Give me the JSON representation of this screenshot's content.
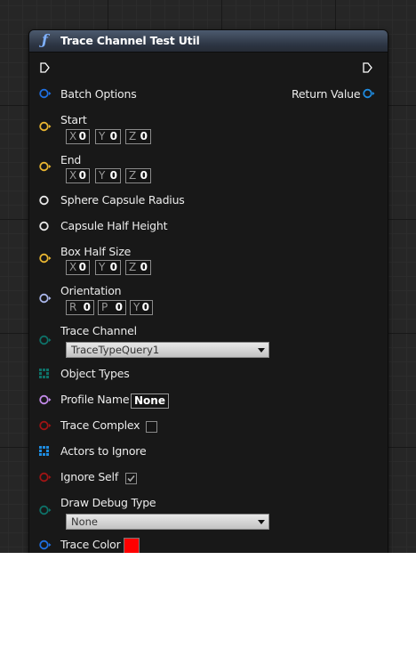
{
  "node": {
    "title": "Trace Channel Test Util",
    "func_icon": "ƒ"
  },
  "colors": {
    "struct_pin": "#1f6fe0",
    "vector_pin": "#e8b531",
    "float_pin": "#e8e8e8",
    "rotator_pin": "#a9b6ea",
    "enum_pin": "#0e7168",
    "array_pin": "#1e8ce0",
    "name_pin": "#c28ae8",
    "bool_pin": "#9e1414",
    "color_value": "#ff0000"
  },
  "pins": {
    "batch_options": {
      "label": "Batch Options"
    },
    "return_value": {
      "label": "Return Value"
    },
    "start": {
      "label": "Start",
      "x_label": "X",
      "x": "0",
      "y_label": "Y",
      "y": "0",
      "z_label": "Z",
      "z": "0"
    },
    "end": {
      "label": "End",
      "x_label": "X",
      "x": "0",
      "y_label": "Y",
      "y": "0",
      "z_label": "Z",
      "z": "0"
    },
    "sphere_capsule_radius": {
      "label": "Sphere Capsule Radius"
    },
    "capsule_half_height": {
      "label": "Capsule Half Height"
    },
    "box_half_size": {
      "label": "Box Half Size",
      "x_label": "X",
      "x": "0",
      "y_label": "Y",
      "y": "0",
      "z_label": "Z",
      "z": "0"
    },
    "orientation": {
      "label": "Orientation",
      "r_label": "R",
      "r": "0",
      "p_label": "P",
      "p": "0",
      "yw_label": "Y",
      "yw": "0"
    },
    "trace_channel": {
      "label": "Trace Channel",
      "value": "TraceTypeQuery1"
    },
    "object_types": {
      "label": "Object Types"
    },
    "profile_name": {
      "label": "Profile Name",
      "value": "None"
    },
    "trace_complex": {
      "label": "Trace Complex",
      "checked": false
    },
    "actors_to_ignore": {
      "label": "Actors to Ignore"
    },
    "ignore_self": {
      "label": "Ignore Self",
      "checked": true
    },
    "draw_debug_type": {
      "label": "Draw Debug Type",
      "value": "None"
    },
    "trace_color": {
      "label": "Trace Color"
    }
  }
}
